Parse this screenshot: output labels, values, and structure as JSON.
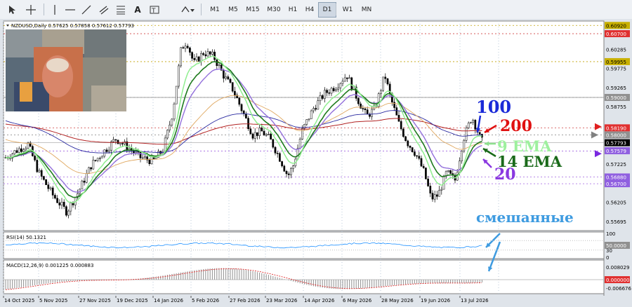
{
  "toolbar": {
    "timeframes": [
      "M1",
      "M5",
      "M15",
      "M30",
      "H1",
      "H4",
      "D1",
      "W1",
      "MN"
    ],
    "active_timeframe": "D1"
  },
  "chart": {
    "symbol_info": "NZDUSD,Daily 0.57625 0.57858 0.57612 0.57793",
    "price_axis": [
      "0.60920",
      "0.60700",
      "0.60285",
      "0.59955",
      "0.59775",
      "0.59265",
      "0.59000",
      "0.58755",
      "0.58190",
      "0.58000",
      "0.57793",
      "0.57579",
      "0.57225",
      "0.56880",
      "0.56700",
      "0.56205",
      "0.55695"
    ],
    "dates": [
      "14 Oct 2025",
      "5 Nov 2025",
      "27 Nov 2025",
      "19 Dec 2025",
      "14 Jan 2026",
      "5 Feb 2026",
      "27 Feb 2026",
      "23 Mar 2026",
      "14 Apr 2026",
      "6 May 2026",
      "28 May 2026",
      "19 Jun 2026",
      "13 Jul 2026"
    ],
    "rsi": {
      "label": "RSI(14) 50.1321",
      "levels": [
        "100",
        "50.0000",
        "30",
        "0"
      ]
    },
    "macd": {
      "label": "MACD(12,26,9) 0.001225 0.000883",
      "levels": [
        "0.008029",
        "0.000000",
        "-0.006676"
      ]
    }
  },
  "annotations": {
    "ema100": "100",
    "ema200": "200",
    "ema9": "9 EMA",
    "ema14": "14 EMA",
    "ema20": "20",
    "mixed": "смешанные"
  },
  "colors": {
    "ema9": "#90ee90",
    "ema14": "#1e7b1e",
    "ema20": "#9370db",
    "ema50": "#e0a860",
    "ema100": "#2a2aa0",
    "ema200": "#b22222",
    "bull": "#ffffff",
    "bear": "#000000"
  }
}
